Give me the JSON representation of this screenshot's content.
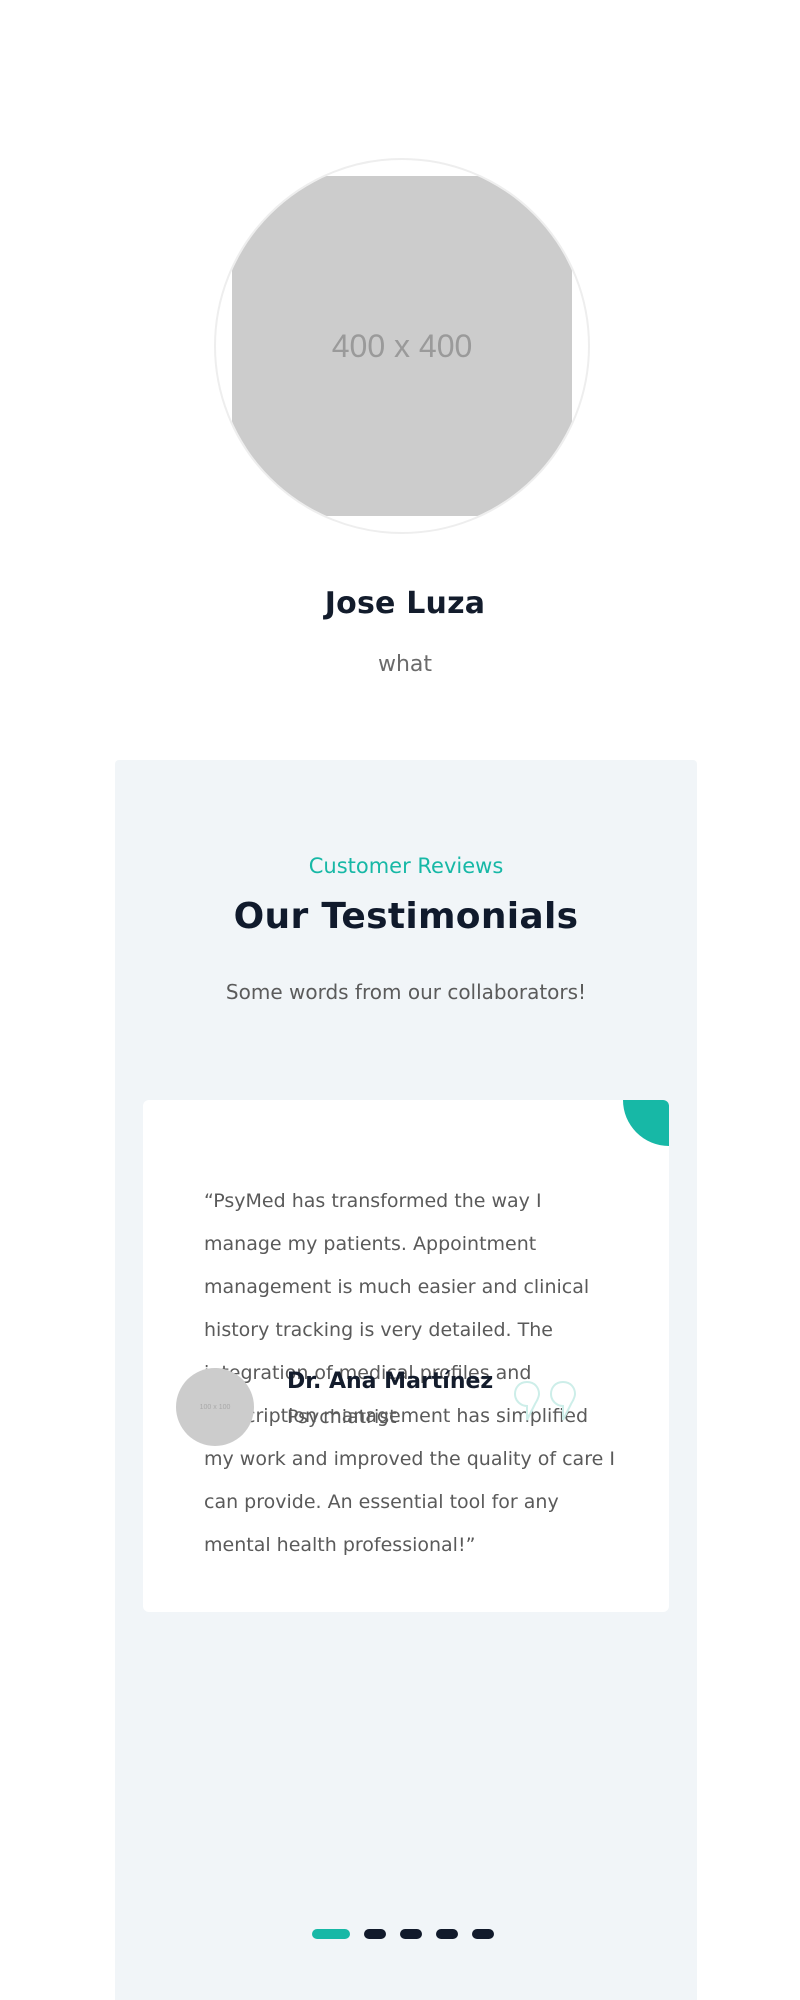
{
  "colors": {
    "accent": "#17b8a6",
    "dark": "#111a2b",
    "section_bg": "#f1f5f8",
    "placeholder": "#cccccc"
  },
  "profile": {
    "image_placeholder": "400 x 400",
    "name": "Jose Luza",
    "role": "what"
  },
  "testimonials": {
    "eyebrow": "Customer Reviews",
    "title": "Our Testimonials",
    "subtitle": "Some words from our collaborators!",
    "card": {
      "quote": "“PsyMed has transformed the way I manage my patients. Appointment management is much easier and clinical history tracking is very detailed. The integration of medical profiles and prescription management has simplified my work and improved the quality of care I can provide. An essential tool for any mental health professional!”",
      "author_image_placeholder": "100 x 100",
      "author_name": "Dr. Ana Martínez",
      "author_role": "Psychiatrist",
      "quote_icon": "quote-marks-icon"
    },
    "carousel": {
      "slides": 5,
      "active_index": 0
    }
  }
}
